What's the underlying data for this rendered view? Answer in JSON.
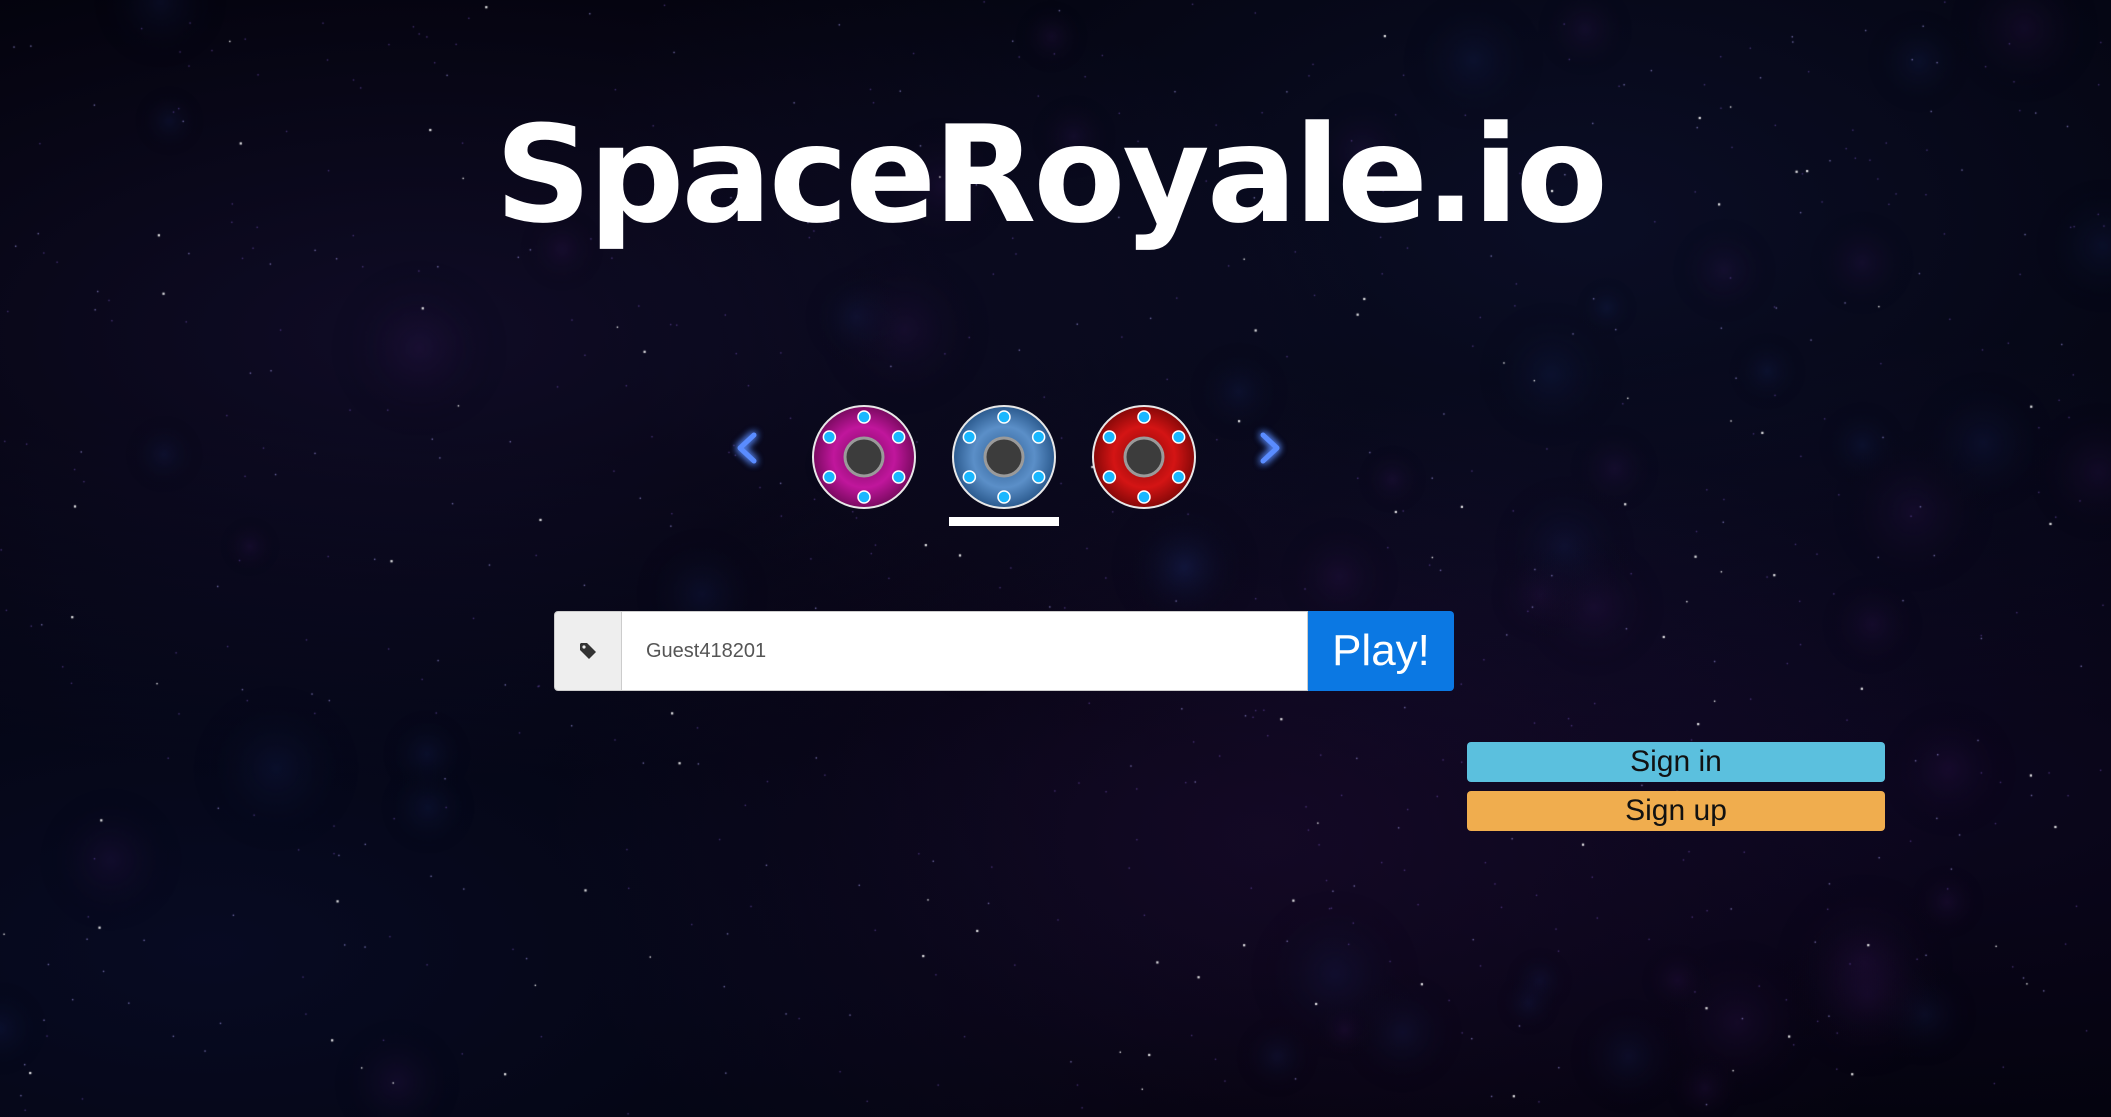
{
  "title": "SpaceRoyale.io",
  "skins": {
    "items": [
      {
        "name": "magenta",
        "body_color": "#c0169c",
        "body_dark": "#7a0a60",
        "selected": false
      },
      {
        "name": "blue",
        "body_color": "#5b8fc8",
        "body_dark": "#2b5a8e",
        "selected": true
      },
      {
        "name": "red",
        "body_color": "#d41414",
        "body_dark": "#860808",
        "selected": false
      }
    ],
    "prev_icon": "chevron-left-icon",
    "next_icon": "chevron-right-icon",
    "arrow_color": "#5a8cff"
  },
  "form": {
    "tag_icon": "tag-icon",
    "name_value": "Guest418201",
    "play_label": "Play!",
    "play_color": "#0b78e3"
  },
  "auth": {
    "signin_label": "Sign in",
    "signin_color": "#5bc0de",
    "signup_label": "Sign up",
    "signup_color": "#f0ad4e"
  }
}
